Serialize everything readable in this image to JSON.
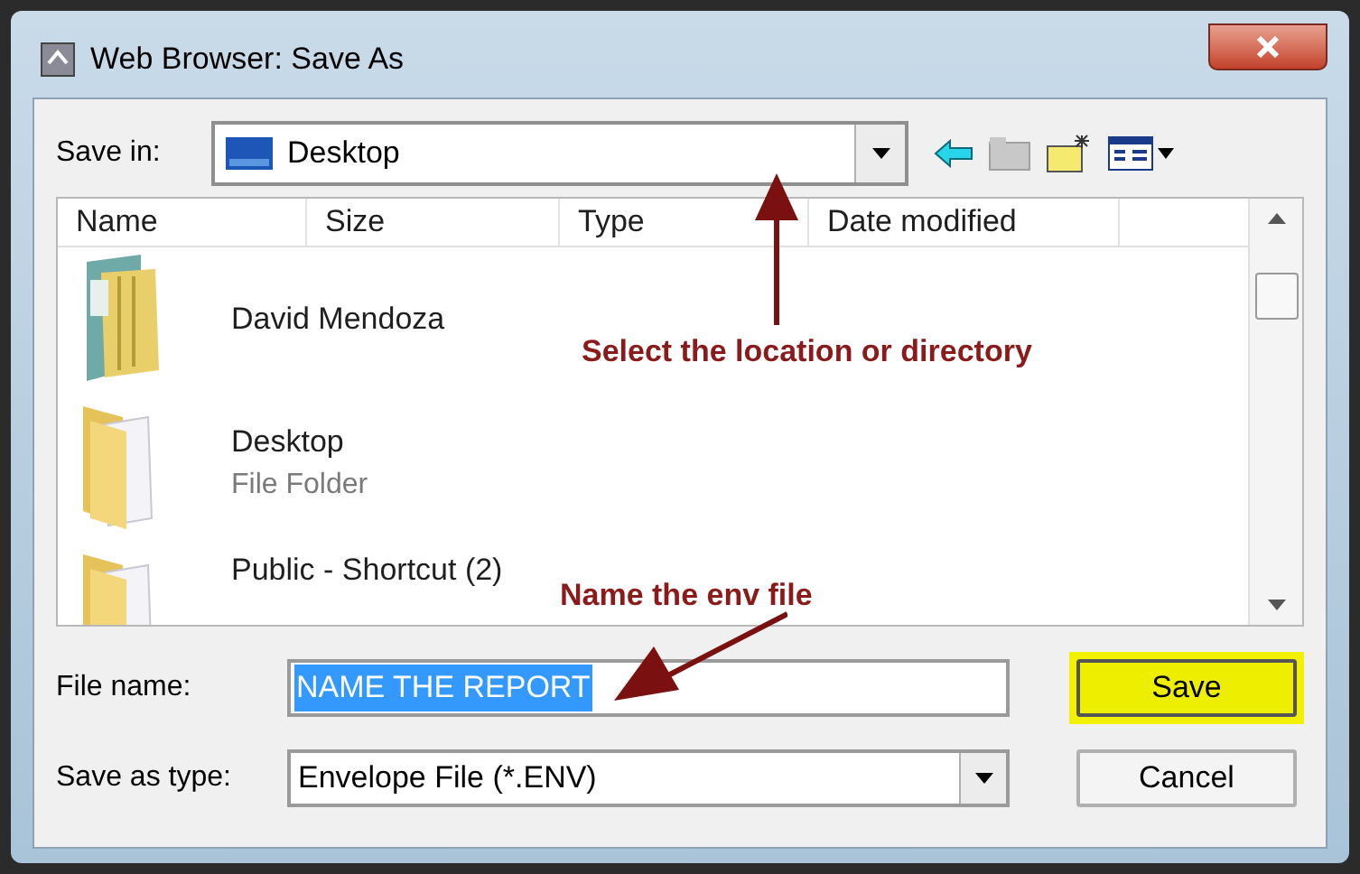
{
  "window": {
    "title": "Web Browser:  Save As"
  },
  "save_in": {
    "label": "Save in:",
    "value": "Desktop"
  },
  "columns": [
    "Name",
    "Size",
    "Type",
    "Date modified"
  ],
  "items": [
    {
      "kind": "user",
      "name": "David Mendoza"
    },
    {
      "kind": "folder",
      "name": "Desktop",
      "type": "File Folder"
    },
    {
      "kind": "folder",
      "name": "Public - Shortcut (2)"
    }
  ],
  "file_name": {
    "label": "File name:",
    "value": "NAME THE REPORT",
    "selected": true
  },
  "save_as_type": {
    "label": "Save as type:",
    "value": "Envelope File (*.ENV)"
  },
  "buttons": [
    {
      "label": "Save",
      "highlighted": true
    },
    {
      "label": "Cancel",
      "highlighted": false
    }
  ],
  "annotations": [
    "Select the location or directory",
    "Name the env file"
  ]
}
